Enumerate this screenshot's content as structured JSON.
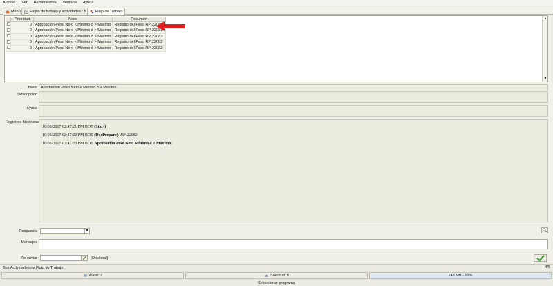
{
  "menu": {
    "items": [
      "Archivo",
      "Ver",
      "Herramientas",
      "Ventana",
      "Ayuda"
    ]
  },
  "tabs": [
    {
      "label": "Menú",
      "icon": "home-icon"
    },
    {
      "label": "Flujos de trabajo y actividades.: 5",
      "icon": "workflow-list-icon"
    },
    {
      "label": "Flujo de Trabajo",
      "icon": "workflow-icon"
    }
  ],
  "grid": {
    "headers": [
      "",
      "Prioridad",
      "Nodo",
      "Resumen"
    ],
    "rows": [
      {
        "priority": "0",
        "node": "Aprobación Peso Neto < Mínimo ó > Maximo",
        "summary": "Registro del Peso RP-22080:"
      },
      {
        "priority": "0",
        "node": "Aprobación Peso Neto < Mínimo ó > Maximo",
        "summary": "Registro del Peso RP-22081:"
      },
      {
        "priority": "0",
        "node": "Aprobación Peso Neto < Mínimo ó > Maximo",
        "summary": "Registro del Peso RP-22083:"
      },
      {
        "priority": "0",
        "node": "Aprobación Peso Neto < Mínimo ó > Maximo",
        "summary": "Registro del Peso RP-22082:"
      },
      {
        "priority": "0",
        "node": "Aprobación Peso Neto < Mínimo ó > Maximo",
        "summary": "Registro del Peso RP-22082:"
      }
    ]
  },
  "form": {
    "node_label": "Nodo",
    "node_value": "Aprobación Peso Neto < Mínimo ó > Maximo",
    "description_label": "Descripción",
    "help_label": "Ayuda",
    "history_label": "Registros históricos",
    "history": [
      {
        "stamp": "10/05/2017 02:47:21 PM BOT",
        "event": "(Start)",
        "extra": ""
      },
      {
        "stamp": "10/05/2017 02:47:22 PM BOT",
        "event": "(DocPrepare)",
        "extra": ": RP-22082"
      },
      {
        "stamp": "10/05/2017 02:47:23 PM BOT",
        "event": "Aprobación Peso Neto Mínimo ó > Maximo",
        "extra": ":"
      }
    ],
    "answer_label": "Respuesta",
    "messages_label": "Mensajes",
    "forward_label": "Re-enviar",
    "optional_label": "(Opcional)"
  },
  "status": {
    "activities": "Sus Actividades de Flujo de Trabajo",
    "page_count": "4/5",
    "alerts": "Aviso: 2",
    "requests": "Solicitud: 0",
    "memory": "248 MB - 69%",
    "footer": "Seleccionar programa"
  },
  "colors": {
    "arrow": "#e02020",
    "ok_button": "#3a9a2a",
    "memory_bar": "#dfe9f3"
  }
}
